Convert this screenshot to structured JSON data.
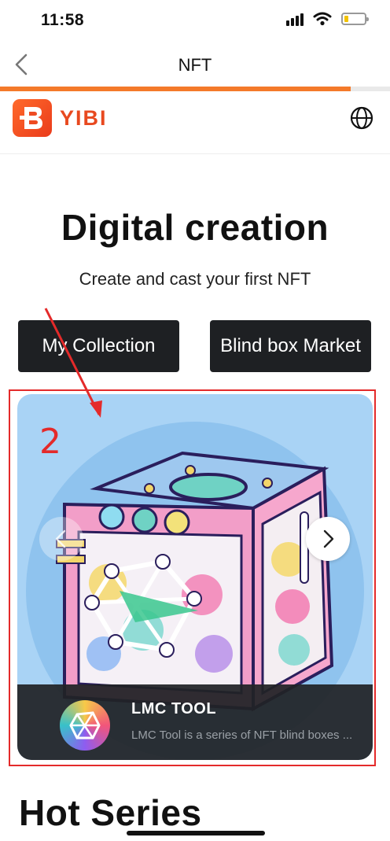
{
  "status_bar": {
    "time": "11:58",
    "signal_icon": "signal-icon",
    "wifi_icon": "wifi-icon",
    "battery_icon": "battery-icon",
    "battery_level": 0.2
  },
  "nav": {
    "title": "NFT",
    "back_icon": "chevron-left-icon",
    "progress": 0.9,
    "accent_color": "#f47a2a"
  },
  "brand": {
    "name": "YIBI",
    "language_icon": "globe-icon",
    "brand_color": "#e8491f"
  },
  "hero": {
    "title": "Digital creation",
    "subtitle": "Create and cast your first NFT",
    "buttons": [
      {
        "label": "My Collection"
      },
      {
        "label": "Blind box Market"
      }
    ]
  },
  "banner": {
    "annotation": "2",
    "title": "LMC TOOL",
    "description": "LMC Tool is a series of NFT blind boxes ...",
    "prev_icon": "chevron-left-icon",
    "next_icon": "chevron-right-icon"
  },
  "sections": {
    "hot_series": "Hot Series"
  }
}
